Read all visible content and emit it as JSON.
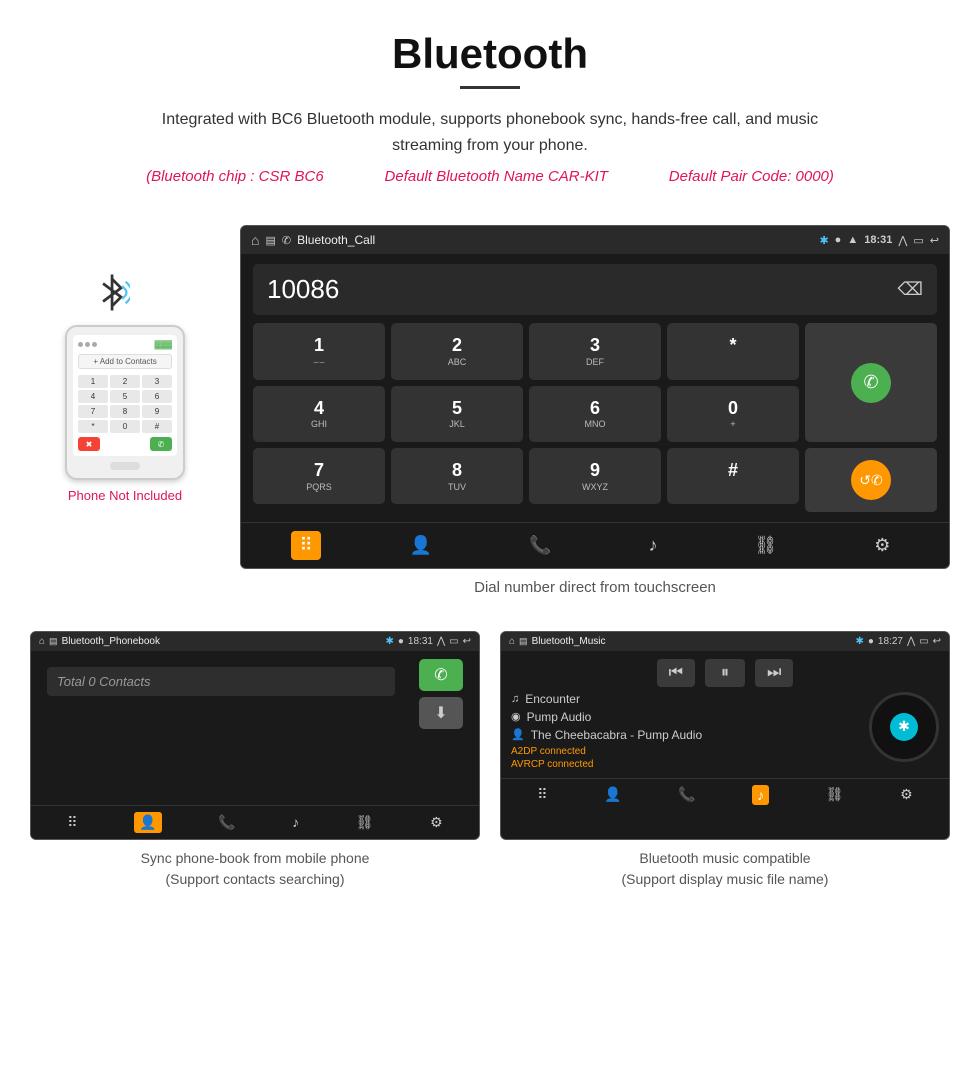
{
  "header": {
    "title": "Bluetooth",
    "description": "Integrated with BC6 Bluetooth module, supports phonebook sync, hands-free call, and music streaming from your phone.",
    "specs": {
      "chip": "(Bluetooth chip : CSR BC6",
      "name": "Default Bluetooth Name CAR-KIT",
      "code": "Default Pair Code: 0000)"
    }
  },
  "phone": {
    "not_included_label": "Phone Not Included"
  },
  "dial_screen": {
    "app_name": "Bluetooth_Call",
    "time": "18:31",
    "dialed_number": "10086",
    "keys": [
      {
        "main": "1",
        "sub": "⌣⌣"
      },
      {
        "main": "2",
        "sub": "ABC"
      },
      {
        "main": "3",
        "sub": "DEF"
      },
      {
        "main": "*",
        "sub": ""
      },
      {
        "main": "4",
        "sub": "GHI"
      },
      {
        "main": "5",
        "sub": "JKL"
      },
      {
        "main": "6",
        "sub": "MNO"
      },
      {
        "main": "0",
        "sub": "+"
      },
      {
        "main": "7",
        "sub": "PQRS"
      },
      {
        "main": "8",
        "sub": "TUV"
      },
      {
        "main": "9",
        "sub": "WXYZ"
      },
      {
        "main": "#",
        "sub": ""
      }
    ],
    "caption": "Dial number direct from touchscreen"
  },
  "phonebook_screen": {
    "app_name": "Bluetooth_Phonebook",
    "time": "18:31",
    "search_placeholder": "Total 0 Contacts",
    "caption": "Sync phone-book from mobile phone\n(Support contacts searching)"
  },
  "music_screen": {
    "app_name": "Bluetooth_Music",
    "time": "18:27",
    "track": "Encounter",
    "audio_source": "Pump Audio",
    "artist": "The Cheebacabra - Pump Audio",
    "status1": "A2DP connected",
    "status2": "AVRCP connected",
    "caption": "Bluetooth music compatible\n(Support display music file name)"
  }
}
